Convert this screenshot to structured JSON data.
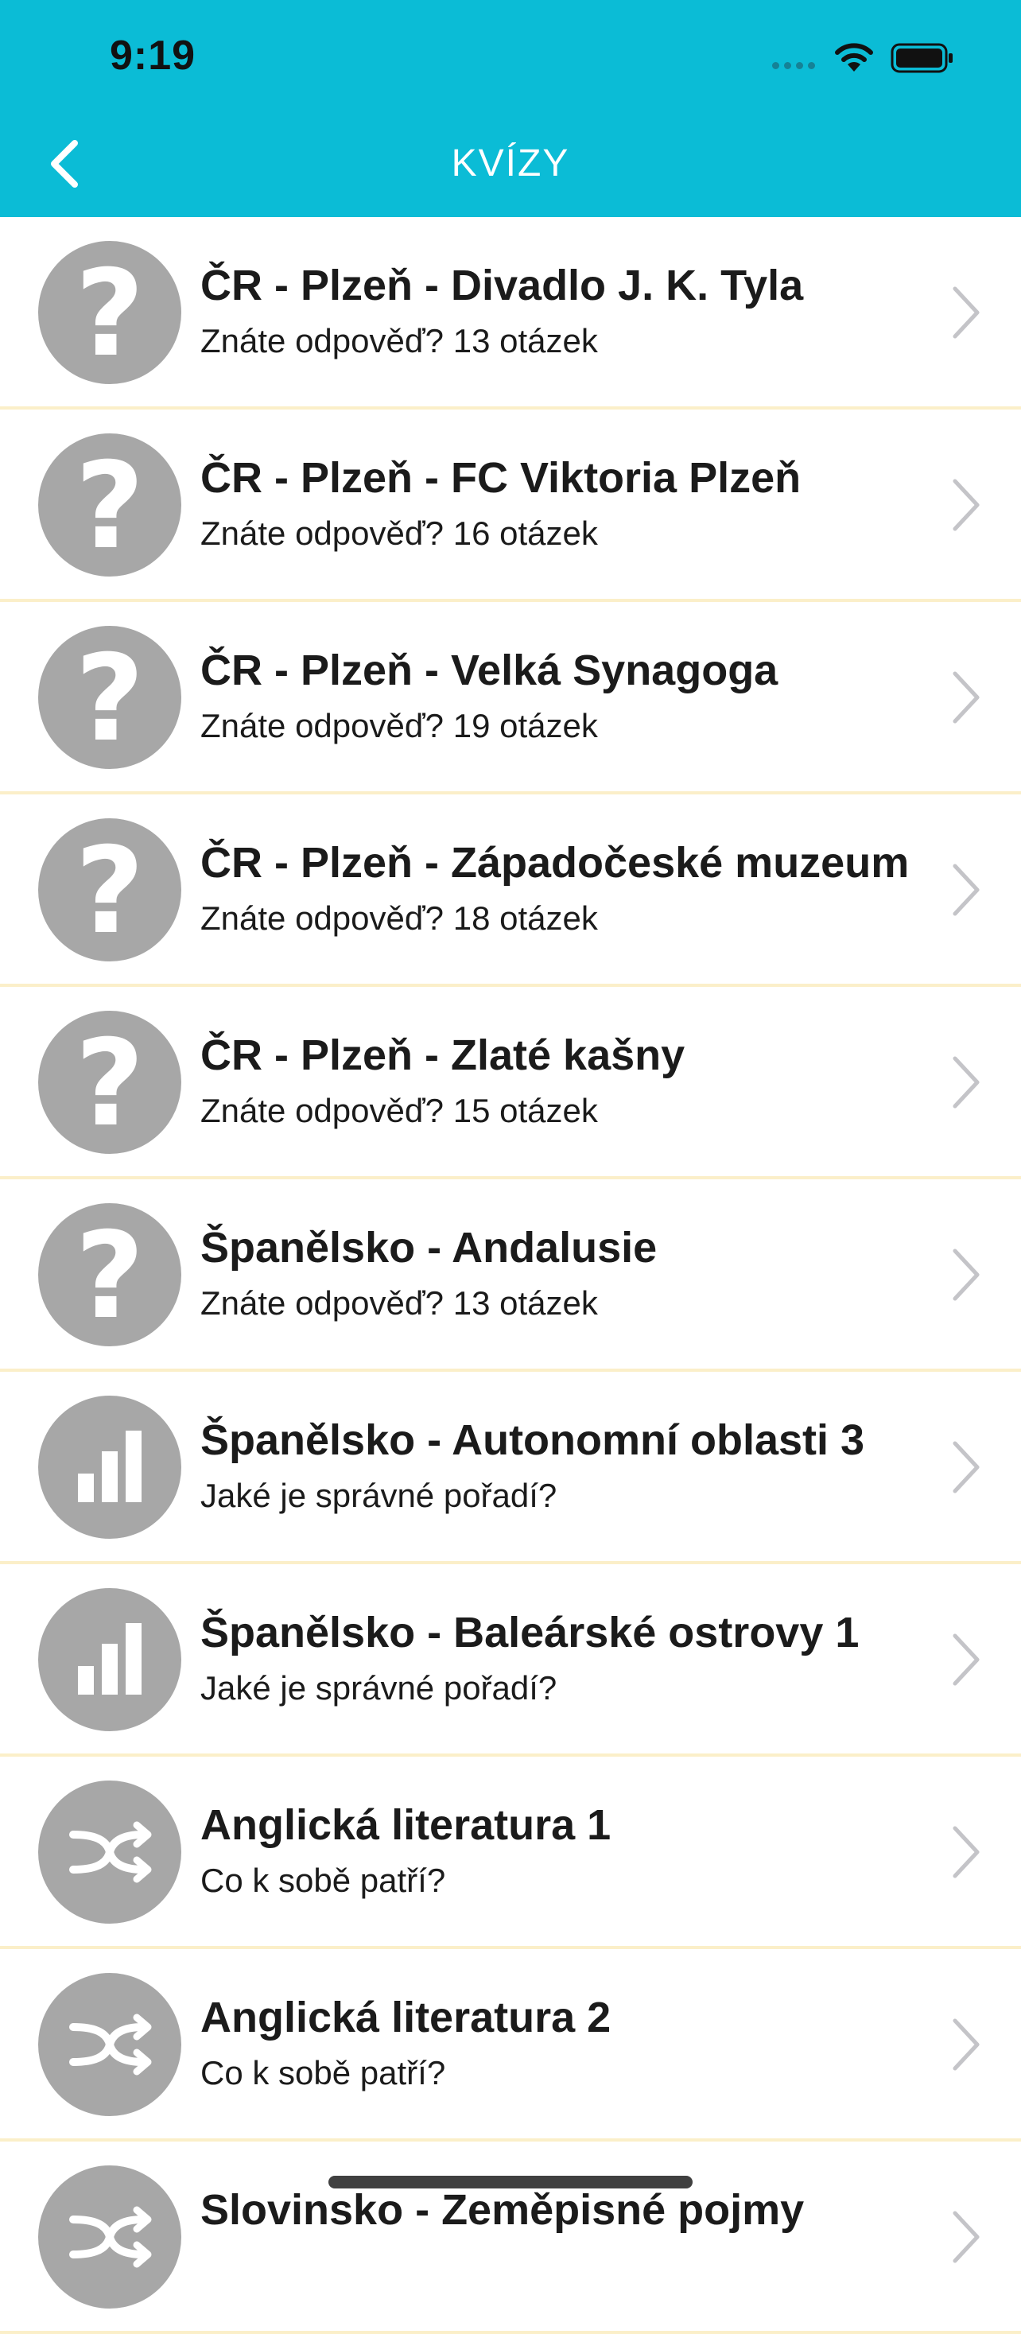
{
  "status_bar": {
    "time": "9:19"
  },
  "nav": {
    "title": "KVÍZY"
  },
  "items": [
    {
      "icon": "question-mark-icon",
      "title": "ČR - Plzeň - Divadlo J. K. Tyla",
      "subtitle": "Znáte odpověď? 13 otázek"
    },
    {
      "icon": "question-mark-icon",
      "title": "ČR - Plzeň - FC Viktoria Plzeň",
      "subtitle": "Znáte odpověď? 16 otázek"
    },
    {
      "icon": "question-mark-icon",
      "title": "ČR - Plzeň - Velká Synagoga",
      "subtitle": "Znáte odpověď? 19 otázek"
    },
    {
      "icon": "question-mark-icon",
      "title": "ČR - Plzeň - Západočeské muzeum",
      "subtitle": "Znáte odpověď? 18 otázek"
    },
    {
      "icon": "question-mark-icon",
      "title": "ČR - Plzeň - Zlaté kašny",
      "subtitle": "Znáte odpověď? 15 otázek"
    },
    {
      "icon": "question-mark-icon",
      "title": "Španělsko - Andalusie",
      "subtitle": "Znáte odpověď? 13 otázek"
    },
    {
      "icon": "bar-chart-icon",
      "title": "Španělsko - Autonomní oblasti 3",
      "subtitle": "Jaké je správné pořadí?"
    },
    {
      "icon": "bar-chart-icon",
      "title": "Španělsko - Baleárské ostrovy 1",
      "subtitle": "Jaké je správné pořadí?"
    },
    {
      "icon": "shuffle-icon",
      "title": "Anglická literatura 1",
      "subtitle": "Co k sobě patří?"
    },
    {
      "icon": "shuffle-icon",
      "title": "Anglická literatura 2",
      "subtitle": "Co k sobě patří?"
    },
    {
      "icon": "shuffle-icon",
      "title": "Slovinsko - Zeměpisné pojmy",
      "subtitle": ""
    }
  ],
  "colors": {
    "header": "#0bbcd6",
    "avatar": "#a7a7a7",
    "separator": "#fbefc9",
    "chevron": "#c4c4c8"
  }
}
